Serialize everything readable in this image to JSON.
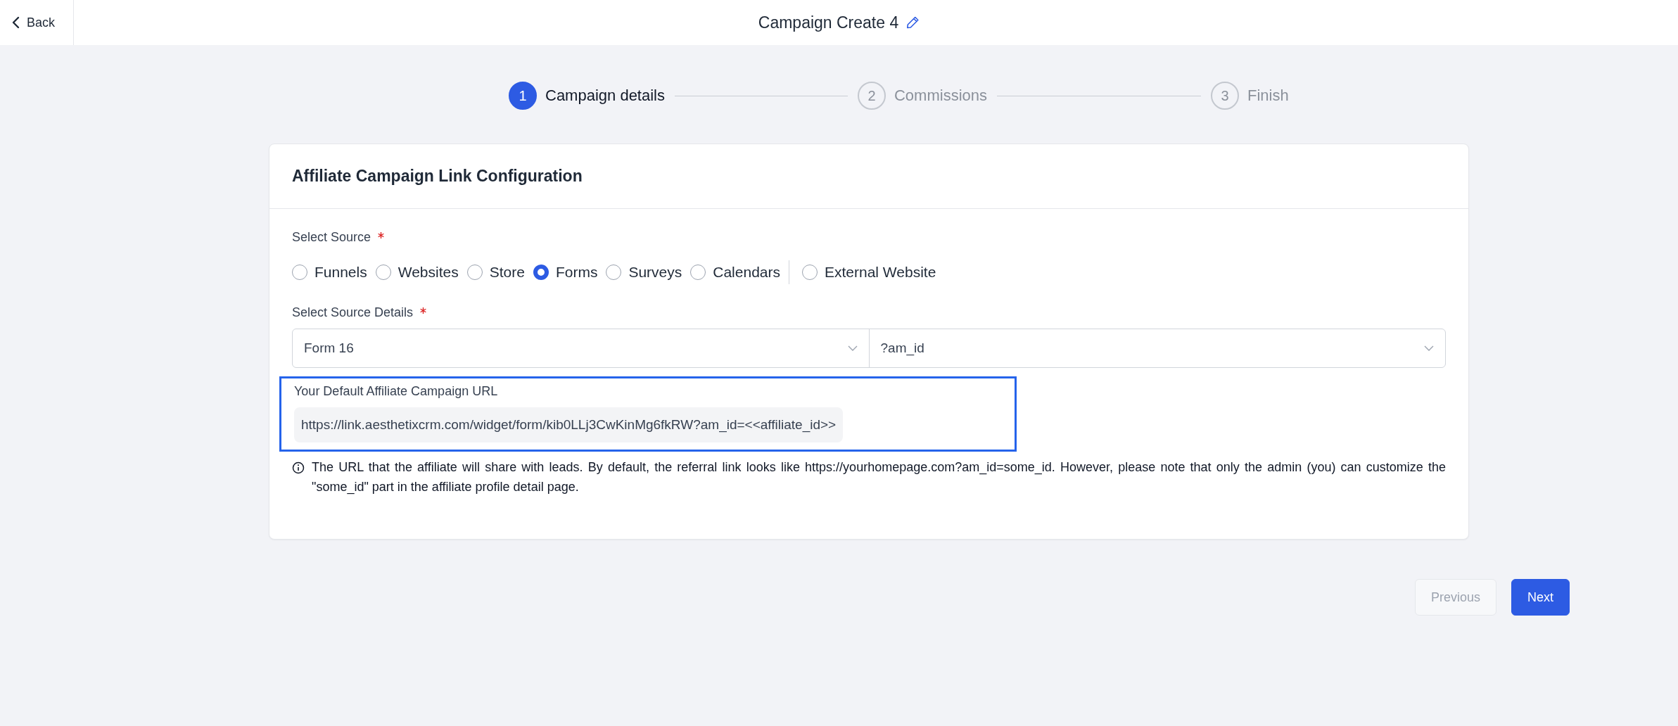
{
  "header": {
    "back_label": "Back",
    "title": "Campaign Create 4"
  },
  "steps": [
    {
      "number": "1",
      "label": "Campaign details",
      "active": true
    },
    {
      "number": "2",
      "label": "Commissions",
      "active": false
    },
    {
      "number": "3",
      "label": "Finish",
      "active": false
    }
  ],
  "card": {
    "title": "Affiliate Campaign Link Configuration",
    "source": {
      "label": "Select Source",
      "required": true,
      "options": [
        {
          "label": "Funnels",
          "selected": false,
          "divider_before": false
        },
        {
          "label": "Websites",
          "selected": false,
          "divider_before": false
        },
        {
          "label": "Store",
          "selected": false,
          "divider_before": false
        },
        {
          "label": "Forms",
          "selected": true,
          "divider_before": false
        },
        {
          "label": "Surveys",
          "selected": false,
          "divider_before": false
        },
        {
          "label": "Calendars",
          "selected": false,
          "divider_before": false
        },
        {
          "label": "External Website",
          "selected": false,
          "divider_before": true
        }
      ]
    },
    "details": {
      "label": "Select Source Details",
      "required": true,
      "selects": [
        {
          "value": "Form 16"
        },
        {
          "value": "?am_id"
        }
      ]
    },
    "url": {
      "label": "Your Default Affiliate Campaign URL",
      "value": "https://link.aesthetixcrm.com/widget/form/kib0LLj3CwKinMg6fkRW?am_id=<<affiliate_id>>",
      "highlighted": true
    },
    "note": "The URL that the affiliate will share with leads. By default, the referral link looks like https://yourhomepage.com?am_id=some_id. However, please note that only the admin (you) can customize the \"some_id\" part in the affiliate profile detail page."
  },
  "buttons": [
    {
      "label": "Previous",
      "kind": "secondary",
      "disabled": true
    },
    {
      "label": "Next",
      "kind": "primary",
      "disabled": false
    }
  ]
}
